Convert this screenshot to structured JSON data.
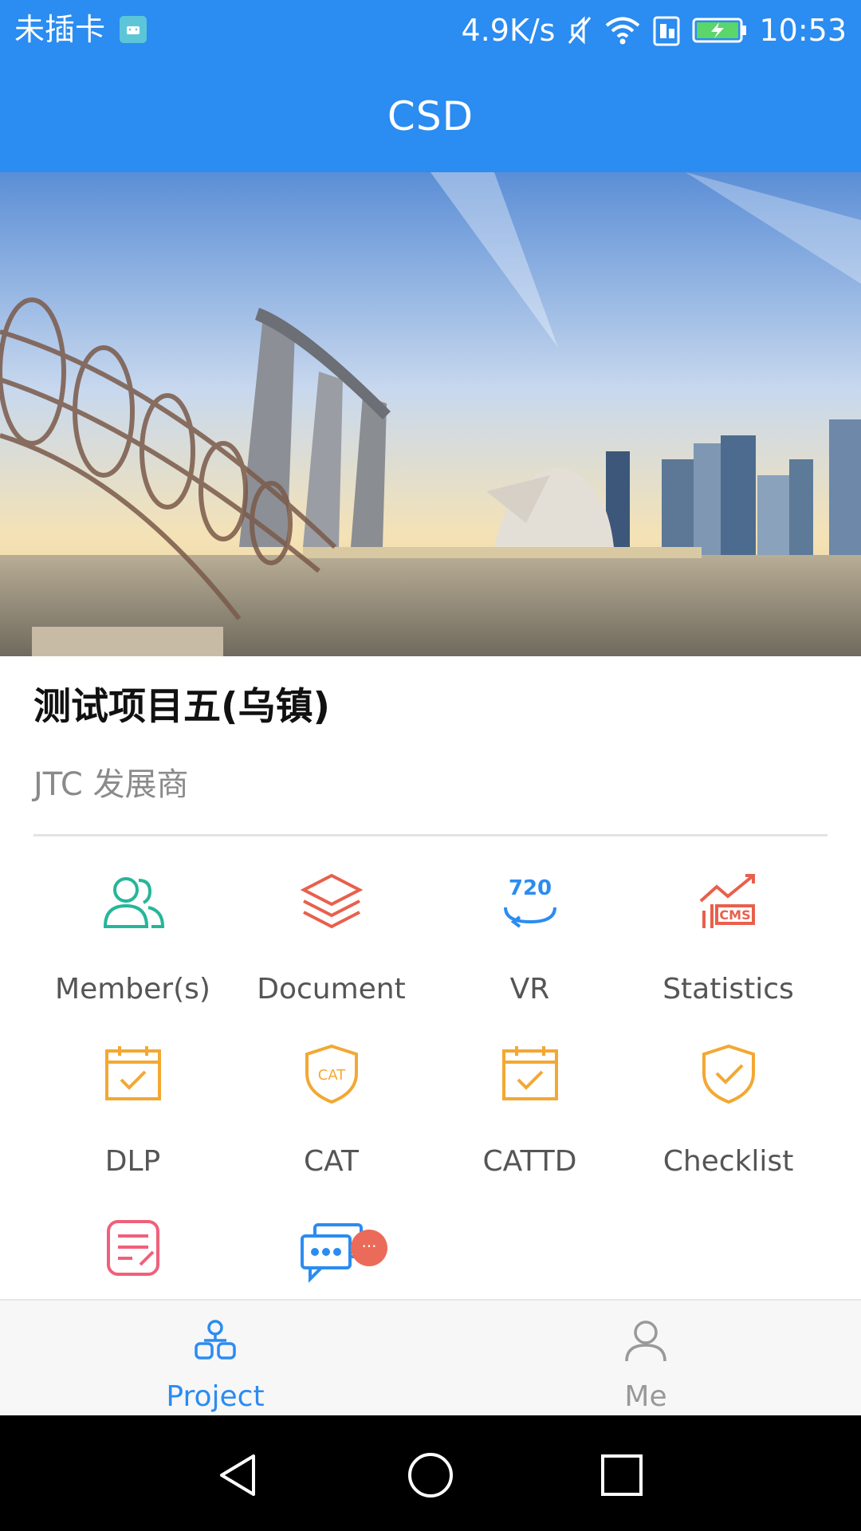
{
  "status_bar": {
    "carrier": "未插卡",
    "speed": "4.9K/s",
    "time": "10:53",
    "icons": [
      "android-icon",
      "mute-icon",
      "wifi-icon",
      "sim-icon",
      "battery-charging-icon"
    ]
  },
  "app_bar": {
    "title": "CSD"
  },
  "banner": {
    "image": "singapore-marina-bay-skyline"
  },
  "project": {
    "title": "测试项目五(乌镇)",
    "developer": "JTC 发展商"
  },
  "modules": [
    {
      "label": "Member(s)",
      "icon": "members-icon",
      "color": "#26b69a"
    },
    {
      "label": "Document",
      "icon": "layers-icon",
      "color": "#e8604c"
    },
    {
      "label": "VR",
      "icon": "vr-720-icon",
      "color": "#2b8cf1"
    },
    {
      "label": "Statistics",
      "icon": "cms-chart-icon",
      "color": "#e8604c"
    },
    {
      "label": "DLP",
      "icon": "calendar-check-icon",
      "color": "#f3a833"
    },
    {
      "label": "CAT",
      "icon": "cat-shield-icon",
      "color": "#f3a833"
    },
    {
      "label": "CATTD",
      "icon": "calendar-check-icon",
      "color": "#f3a833"
    },
    {
      "label": "Checklist",
      "icon": "shield-check-icon",
      "color": "#f3a833"
    },
    {
      "label": "",
      "icon": "notes-edit-icon",
      "color": "#f0607a"
    },
    {
      "label": "",
      "icon": "chat-bubbles-icon",
      "color": "#2b8cf1"
    }
  ],
  "chat_badge": "···",
  "bottom_nav": {
    "items": [
      {
        "label": "Project",
        "icon": "project-icon",
        "active": true,
        "color": "#2b8cf1"
      },
      {
        "label": "Me",
        "icon": "person-icon",
        "active": false,
        "color": "#999999"
      }
    ]
  },
  "system_nav": [
    "back-icon",
    "home-icon",
    "recents-icon"
  ]
}
